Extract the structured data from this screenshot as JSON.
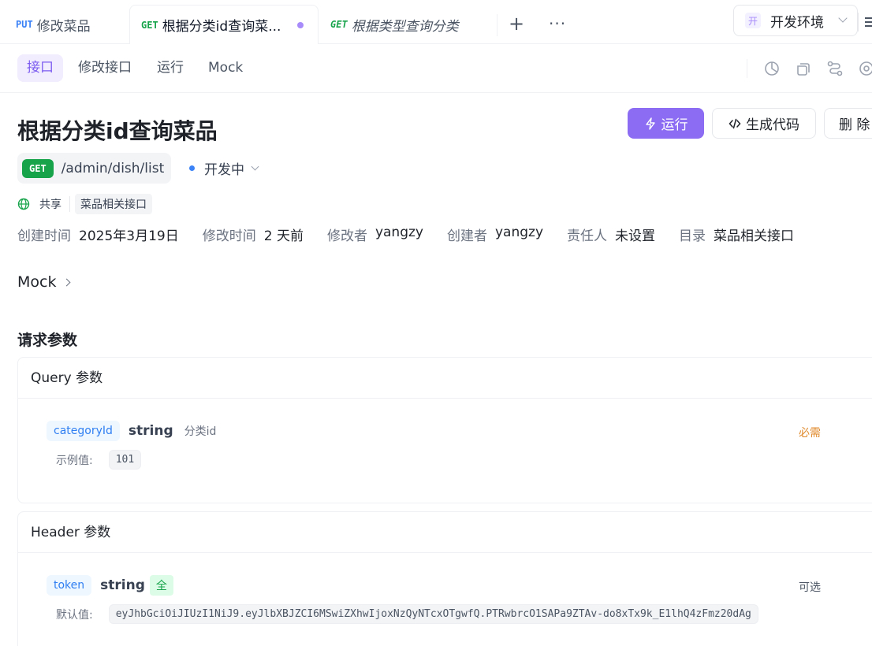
{
  "tabs": [
    {
      "method": "PUT",
      "label": "修改菜品"
    },
    {
      "method": "GET",
      "label": "根据分类id查询菜..."
    },
    {
      "method": "GET",
      "label": "根据类型查询分类"
    }
  ],
  "env": {
    "badge": "开",
    "label": "开发环境"
  },
  "subnav": [
    "接口",
    "修改接口",
    "运行",
    "Mock"
  ],
  "title": "根据分类id查询菜品",
  "buttons": {
    "run": "运行",
    "gen": "生成代码",
    "del": "删 除"
  },
  "method": "GET",
  "path": "/admin/dish/list",
  "status": "开发中",
  "share": {
    "label": "共享",
    "tag": "菜品相关接口"
  },
  "meta": [
    {
      "k": "创建时间",
      "v": "2025年3月19日"
    },
    {
      "k": "修改时间",
      "v": "2 天前"
    },
    {
      "k": "修改者",
      "v": "yangzy"
    },
    {
      "k": "创建者",
      "v": "yangzy"
    },
    {
      "k": "责任人",
      "v": "未设置"
    },
    {
      "k": "目录",
      "v": "菜品相关接口"
    }
  ],
  "mock_label": "Mock",
  "section_title": "请求参数",
  "query": {
    "title": "Query 参数",
    "name": "categoryId",
    "type": "string",
    "desc": "分类id",
    "required": "必需",
    "example_label": "示例值:",
    "example": "101"
  },
  "header": {
    "title": "Header 参数",
    "name": "token",
    "type": "string",
    "badge": "全",
    "required": "可选",
    "default_label": "默认值:",
    "default": "eyJhbGciOiJIUzI1NiJ9.eyJlbXBJZCI6MSwiZXhwIjoxNzQyNTcxOTgwfQ.PTRwbrcO1SAPa9ZTAv-do8xTx9k_E1lhQ4zFmz20dAg"
  }
}
